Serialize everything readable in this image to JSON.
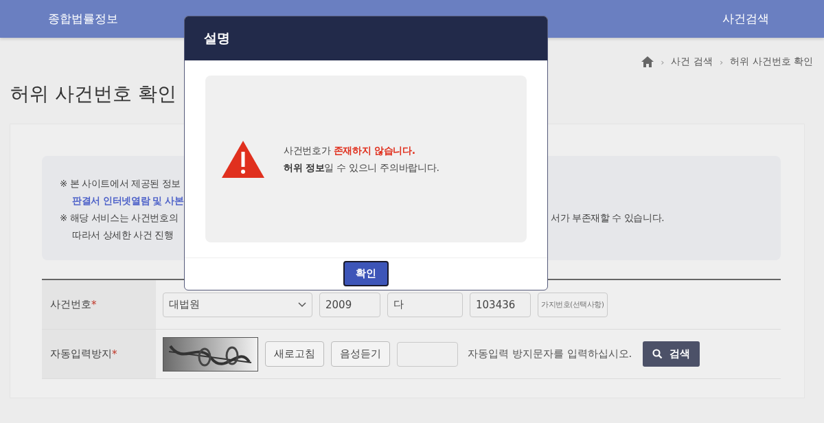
{
  "nav": {
    "items": [
      {
        "label": "종합법률정보"
      },
      {
        "label": "사건검색"
      }
    ]
  },
  "breadcrumb": [
    {
      "separator": "›",
      "label": "사건 검색"
    },
    {
      "separator": "›",
      "label": "허위 사건번호 확인"
    }
  ],
  "page_title": "허위 사건번호 확인",
  "notice": {
    "lines": [
      {
        "kind": "note",
        "text": "※ 본 사이트에서 제공된 정보"
      },
      {
        "kind": "link",
        "text": "판결서 인터넷열람 및 사본"
      },
      {
        "kind": "note",
        "text": "※ 해당 서비스는 사건번호의",
        "tail": "서가 부존재할 수 있습니다."
      },
      {
        "kind": "note",
        "text": "따라서 상세한 사건 진행"
      }
    ]
  },
  "form": {
    "case_row": {
      "label": "사건번호",
      "required_mark": "*",
      "court": "대법원",
      "year": "2009",
      "type": "다",
      "number": "103436",
      "branch_placeholder": "가지번호(선택사항)"
    },
    "captcha_row": {
      "label": "자동입력방지",
      "required_mark": "*",
      "refresh": "새로고침",
      "audio": "음성듣기",
      "hint": "자동입력 방지문자를 입력하십시오.",
      "search": "검색"
    }
  },
  "dialog": {
    "title": "설명",
    "lines": [
      "사건번호가 **존재하지 않습니다.**",
      "**허위 정보**일 수 있으니 주의바랍니다."
    ],
    "button": "확인"
  }
}
